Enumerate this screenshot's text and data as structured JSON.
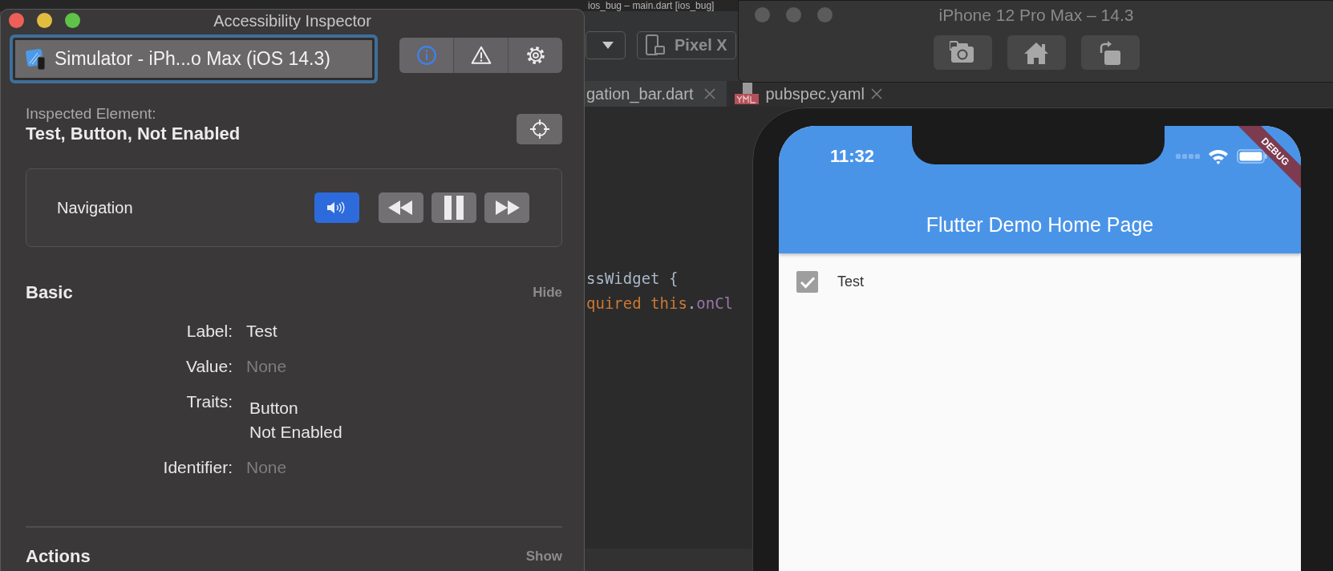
{
  "ide": {
    "title": "ios_bug – main.dart [ios_bug]",
    "device_button": "Pixel X",
    "tabs": [
      {
        "label": "gation_bar.dart",
        "kind": "dart",
        "selected": true
      },
      {
        "label": "pubspec.yaml",
        "kind": "yaml",
        "selected": false
      }
    ],
    "code_lines": [
      [
        {
          "text": "ssWidget {",
          "kind": "plain"
        }
      ],
      [
        {
          "text": "quired this",
          "kind": "keyword"
        },
        {
          "text": ".",
          "kind": "plain"
        },
        {
          "text": "onCl",
          "kind": "field"
        }
      ]
    ]
  },
  "inspector": {
    "title": "Accessibility Inspector",
    "target": "Simulator - iPh...o Max (iOS 14.3)",
    "tools": [
      {
        "kind": "info",
        "selected": true
      },
      {
        "kind": "warning",
        "selected": false
      },
      {
        "kind": "settings",
        "selected": false
      }
    ],
    "inspected_label": "Inspected Element:",
    "inspected_value": "Test, Button, Not Enabled",
    "navigation": {
      "label": "Navigation",
      "speech_on": true
    },
    "sections": [
      {
        "title": "Basic",
        "toggle": "Hide",
        "fields": [
          {
            "label": "Label:",
            "values": [
              "Test"
            ],
            "empty": false
          },
          {
            "label": "Value:",
            "values": [
              "None"
            ],
            "empty": true
          },
          {
            "label": "Traits:",
            "values": [
              "Button",
              "Not Enabled"
            ],
            "empty": false
          },
          {
            "label": "Identifier:",
            "values": [
              "None"
            ],
            "empty": true
          }
        ]
      },
      {
        "title": "Actions",
        "toggle": "Show"
      }
    ]
  },
  "simulator": {
    "title": "iPhone 12 Pro Max – 14.3",
    "buttons": [
      {
        "kind": "screenshot"
      },
      {
        "kind": "home"
      },
      {
        "kind": "rotate"
      }
    ]
  },
  "phone": {
    "time": "11:32",
    "banner": "DEBUG",
    "app_title": "Flutter Demo Home Page",
    "items": [
      {
        "label": "Test",
        "checked": true,
        "disabled": true
      }
    ]
  }
}
